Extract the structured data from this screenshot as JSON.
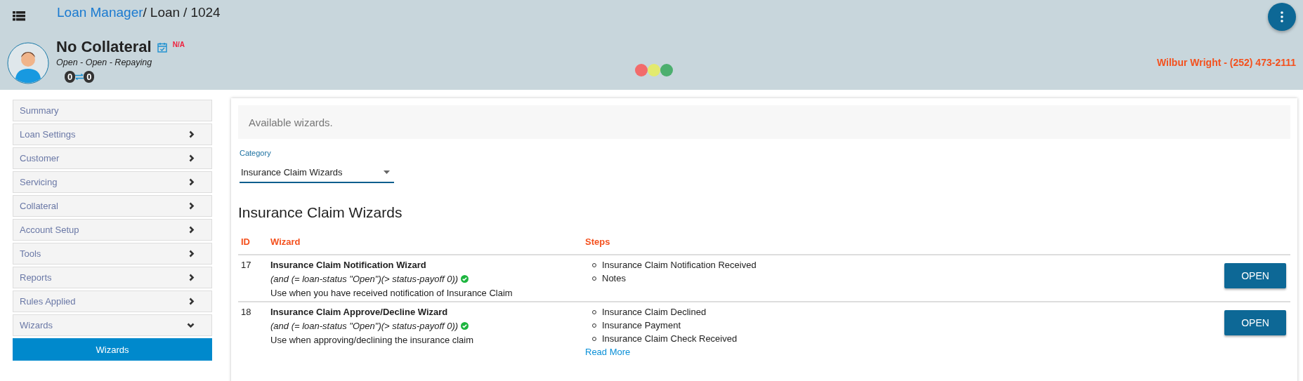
{
  "breadcrumb": {
    "root": "Loan Manager",
    "separator": "/",
    "items": [
      "Loan",
      "1024"
    ]
  },
  "loan": {
    "title": "No Collateral",
    "flag": "N/A",
    "status": "Open - Open - Repaying",
    "counters": [
      "0",
      "0"
    ]
  },
  "lights": [
    {
      "color": "#f26b6b"
    },
    {
      "color": "#e3ea6e"
    },
    {
      "color": "#4caf6e"
    }
  ],
  "contact": "Wilbur Wright - (252) 473-2111",
  "sidebar": {
    "items": [
      {
        "label": "Summary",
        "kind": "link"
      },
      {
        "label": "Loan Settings",
        "kind": "group",
        "expanded": false
      },
      {
        "label": "Customer",
        "kind": "group",
        "expanded": false
      },
      {
        "label": "Servicing",
        "kind": "group",
        "expanded": false
      },
      {
        "label": "Collateral",
        "kind": "group",
        "expanded": false
      },
      {
        "label": "Account Setup",
        "kind": "group",
        "expanded": false
      },
      {
        "label": "Tools",
        "kind": "group",
        "expanded": false
      },
      {
        "label": "Reports",
        "kind": "group",
        "expanded": false
      },
      {
        "label": "Rules Applied",
        "kind": "group",
        "expanded": false
      },
      {
        "label": "Wizards",
        "kind": "group",
        "expanded": true,
        "children": [
          {
            "label": "Wizards",
            "selected": true
          }
        ]
      }
    ]
  },
  "info": "Available wizards.",
  "category": {
    "label": "Category",
    "value": "Insurance Claim Wizards"
  },
  "heading": "Insurance Claim Wizards",
  "table": {
    "columns": [
      "ID",
      "Wizard",
      "Steps"
    ],
    "rows": [
      {
        "id": "17",
        "name": "Insurance Claim Notification Wizard",
        "rule": "(and (= loan-status \"Open\")(> status-payoff 0))",
        "rule_ok": true,
        "description": "Use when you have received notification of Insurance Claim",
        "steps": [
          "Insurance Claim Notification Received",
          "Notes"
        ],
        "action": "OPEN"
      },
      {
        "id": "18",
        "name": "Insurance Claim Approve/Decline Wizard",
        "rule": "(and (= loan-status \"Open\")(> status-payoff 0))",
        "rule_ok": true,
        "description": "Use when approving/declining the insurance claim",
        "steps": [
          "Insurance Claim Declined",
          "Insurance Payment",
          "Insurance Claim Check Received"
        ],
        "more": "Read More",
        "action": "OPEN"
      }
    ]
  }
}
